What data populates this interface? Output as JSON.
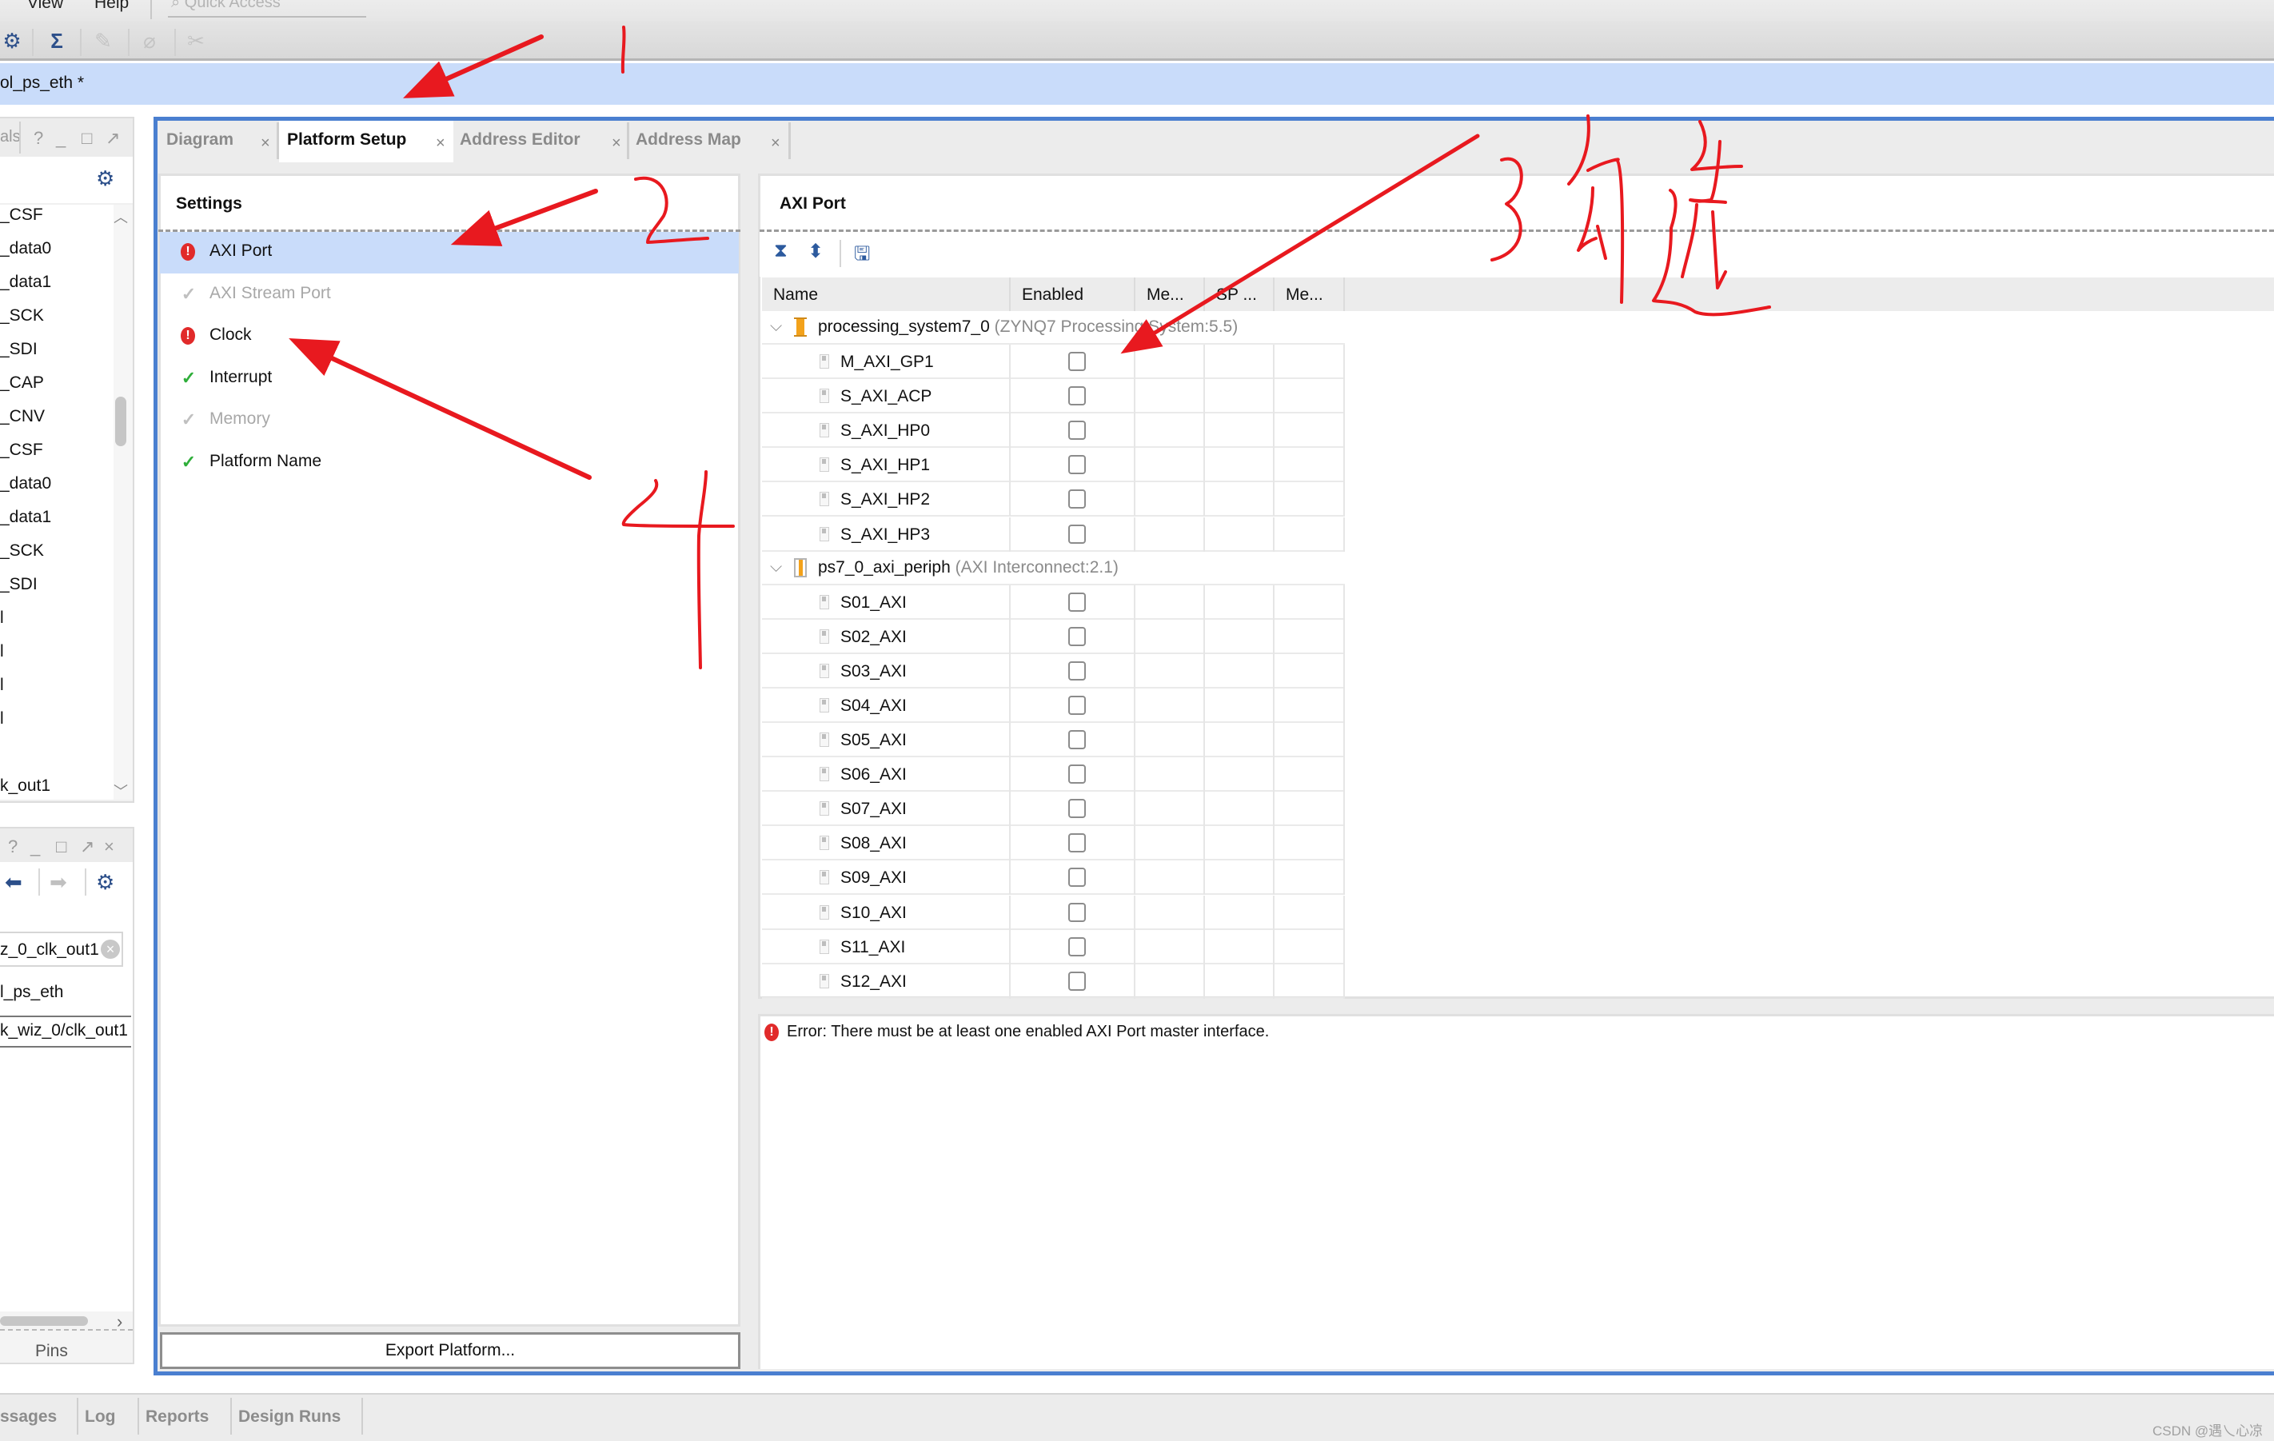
{
  "menu": {
    "items": [
      {
        "label": "View",
        "mnemonic": "V"
      },
      {
        "label": "Help",
        "mnemonic": "H"
      }
    ],
    "quick_access_placeholder": "Quick Access"
  },
  "toolbar": {
    "icons": [
      "gear-icon",
      "sigma-icon",
      "edit-disabled-icon",
      "link-disabled-icon",
      "cut-disabled-icon"
    ]
  },
  "design": {
    "title": "ol_ps_eth *"
  },
  "left_top_panel": {
    "title": "als",
    "buttons": [
      "?",
      "_",
      "□",
      "↗"
    ],
    "signals": [
      "_CSF",
      "_data0",
      "_data1",
      "_SCK",
      "_SDI",
      "_CAP",
      "_CNV",
      "_CSF",
      "_data0",
      "_data1",
      "_SCK",
      "_SDI",
      "l",
      "l",
      "l",
      "l",
      "",
      "k_out1"
    ]
  },
  "left_bottom_panel": {
    "buttons": [
      "?",
      "_",
      "□",
      "↗",
      "×"
    ],
    "search_value": "z_0_clk_out1",
    "object_name": "l_ps_eth",
    "object_path": "k_wiz_0/clk_out1",
    "tab_label": "Pins"
  },
  "tabs": [
    {
      "label": "Diagram",
      "active": false
    },
    {
      "label": "Platform Setup",
      "active": true
    },
    {
      "label": "Address Editor",
      "active": false
    },
    {
      "label": "Address Map",
      "active": false
    }
  ],
  "settings": {
    "title": "Settings",
    "items": [
      {
        "label": "AXI Port",
        "status": "error",
        "selected": true,
        "enabled": true
      },
      {
        "label": "AXI Stream Port",
        "status": "ok",
        "selected": false,
        "enabled": false
      },
      {
        "label": "Clock",
        "status": "error",
        "selected": false,
        "enabled": true
      },
      {
        "label": "Interrupt",
        "status": "ok",
        "selected": false,
        "enabled": true
      },
      {
        "label": "Memory",
        "status": "ok",
        "selected": false,
        "enabled": false
      },
      {
        "label": "Platform Name",
        "status": "ok",
        "selected": false,
        "enabled": true
      }
    ],
    "export_button": "Export Platform..."
  },
  "axi_port": {
    "title": "AXI Port",
    "toolbar": [
      "collapse-all-icon",
      "expand-all-icon",
      "save-icon"
    ],
    "columns": [
      "Name",
      "Enabled",
      "Me...",
      "SP ...",
      "Me..."
    ],
    "groups": [
      {
        "name": "processing_system7_0",
        "desc": "(ZYNQ7 Processing System:5.5)",
        "ports": [
          {
            "name": "M_AXI_GP1",
            "enabled": false
          },
          {
            "name": "S_AXI_ACP",
            "enabled": false
          },
          {
            "name": "S_AXI_HP0",
            "enabled": false
          },
          {
            "name": "S_AXI_HP1",
            "enabled": false
          },
          {
            "name": "S_AXI_HP2",
            "enabled": false
          },
          {
            "name": "S_AXI_HP3",
            "enabled": false
          }
        ]
      },
      {
        "name": "ps7_0_axi_periph",
        "desc": "(AXI Interconnect:2.1)",
        "ports": [
          {
            "name": "S01_AXI",
            "enabled": false
          },
          {
            "name": "S02_AXI",
            "enabled": false
          },
          {
            "name": "S03_AXI",
            "enabled": false
          },
          {
            "name": "S04_AXI",
            "enabled": false
          },
          {
            "name": "S05_AXI",
            "enabled": false
          },
          {
            "name": "S06_AXI",
            "enabled": false
          },
          {
            "name": "S07_AXI",
            "enabled": false
          },
          {
            "name": "S08_AXI",
            "enabled": false
          },
          {
            "name": "S09_AXI",
            "enabled": false
          },
          {
            "name": "S10_AXI",
            "enabled": false
          },
          {
            "name": "S11_AXI",
            "enabled": false
          },
          {
            "name": "S12_AXI",
            "enabled": false
          }
        ]
      }
    ]
  },
  "messages": {
    "error": "Error: There must be at least one enabled AXI Port master interface."
  },
  "bottom_tabs": [
    "ssages",
    "Log",
    "Reports",
    "Design Runs"
  ],
  "watermark": "CSDN @遇乀心凉",
  "annotations": {
    "color": "#e8191f",
    "labels": [
      "1",
      "2",
      "3",
      "4",
      "勾选"
    ]
  },
  "colors": {
    "accent_blue": "#4a7fd0",
    "selection": "#c9dcfa",
    "error": "#e12a2a",
    "ok": "#2fae3a"
  }
}
